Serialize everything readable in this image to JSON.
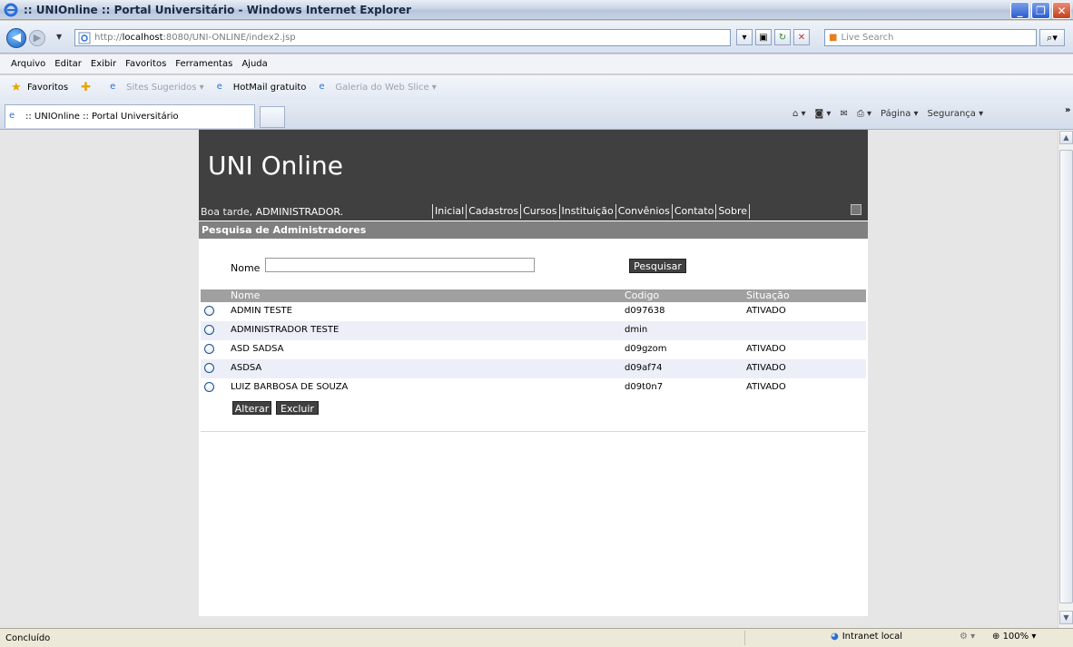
{
  "window": {
    "title": ":: UNIOnline :: Portal Universitário - Windows Internet Explorer"
  },
  "addressbar": {
    "url_prefix": "http://",
    "url_host": "localhost",
    "url_rest": ":8080/UNI-ONLINE/index2.jsp",
    "search_placeholder": "Live Search"
  },
  "menubar": {
    "items": [
      "Arquivo",
      "Editar",
      "Exibir",
      "Favoritos",
      "Ferramentas",
      "Ajuda"
    ]
  },
  "favoritesbar": {
    "favorites_label": "Favoritos",
    "items": [
      "Sites Sugeridos ▾",
      "HotMail gratuito",
      "Galeria do Web Slice ▾"
    ]
  },
  "tabs": {
    "active_tab": ":: UNIOnline :: Portal Universitário"
  },
  "commandbar": {
    "page_label": "Página ▾",
    "security_label": "Segurança ▾"
  },
  "site": {
    "logo": "UNI Online",
    "greeting_prefix": "Boa tarde, ",
    "greeting_user": "ADMINISTRADOR.",
    "nav": [
      "Inicial",
      "Cadastros",
      "Cursos",
      "Instituição",
      "Convênios",
      "Contato",
      "Sobre"
    ],
    "section_title": "Pesquisa de Administradores",
    "search": {
      "label": "Nome",
      "value": "",
      "button": "Pesquisar"
    },
    "table": {
      "headers": {
        "name": "Nome",
        "code": "Codigo",
        "status": "Situação"
      },
      "rows": [
        {
          "name": "ADMIN TESTE",
          "code": "d097638",
          "status": "ATIVADO"
        },
        {
          "name": "ADMINISTRADOR TESTE",
          "code": "dmin",
          "status": ""
        },
        {
          "name": "ASD SADSA",
          "code": "d09gzom",
          "status": "ATIVADO"
        },
        {
          "name": "ASDSA",
          "code": "d09af74",
          "status": "ATIVADO"
        },
        {
          "name": "LUIZ BARBOSA DE SOUZA",
          "code": "d09t0n7",
          "status": "ATIVADO"
        }
      ]
    },
    "actions": {
      "edit": "Alterar",
      "delete": "Excluir"
    }
  },
  "statusbar": {
    "status": "Concluído",
    "zone": "Intranet local",
    "zoom": "100%"
  },
  "colors": {
    "header_bg": "#404040",
    "section_bg": "#808080",
    "alt_row_bg": "#eceef8"
  }
}
